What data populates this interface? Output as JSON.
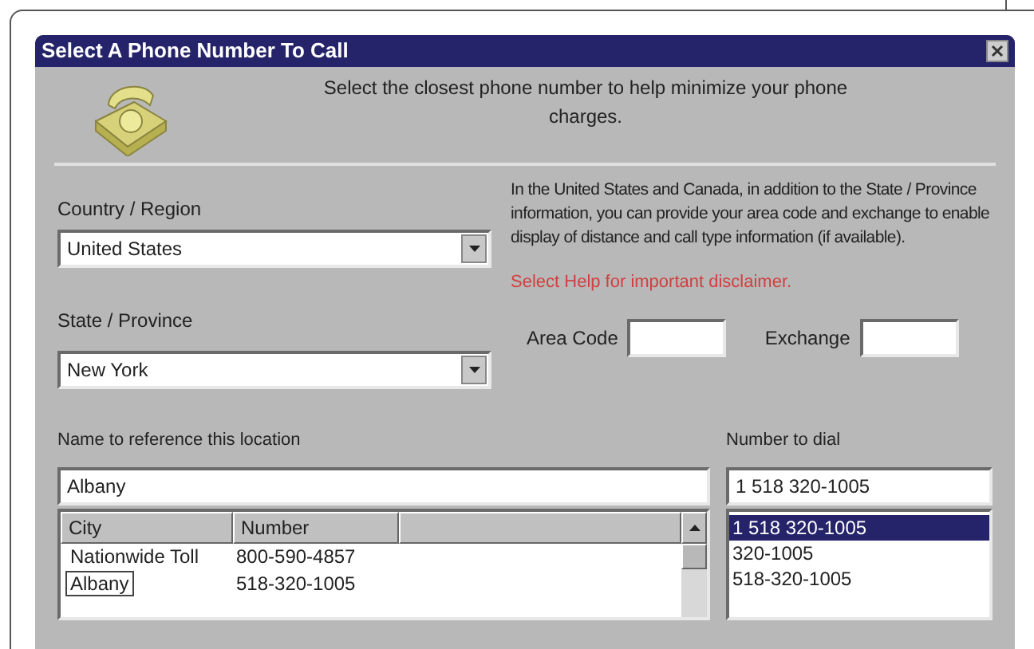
{
  "window": {
    "title": "Select A Phone Number To Call"
  },
  "intro": "Select the closest phone number to help minimize your phone charges.",
  "country": {
    "label": "Country / Region",
    "value": "United States"
  },
  "state": {
    "label": "State / Province",
    "value": "New York"
  },
  "info": "In the United States and Canada, in addition to the State / Province information, you can provide your area code and exchange to enable display of distance and call type information (if available).",
  "help_note": "Select Help for important disclaimer.",
  "area_code": {
    "label": "Area Code"
  },
  "exchange": {
    "label": "Exchange"
  },
  "location_name": {
    "label": "Name to reference this location",
    "value": "Albany"
  },
  "table": {
    "columns": [
      "City",
      "Number"
    ],
    "rows": [
      {
        "city": "Nationwide Toll",
        "number": "800-590-4857",
        "selected": false
      },
      {
        "city": "Albany",
        "number": "518-320-1005",
        "selected": true
      }
    ]
  },
  "number_to_dial": {
    "label": "Number to dial",
    "value": "1 518 320-1005",
    "options": [
      {
        "label": "1 518 320-1005",
        "selected": true
      },
      {
        "label": "320-1005",
        "selected": false
      },
      {
        "label": "518-320-1005",
        "selected": false
      }
    ]
  }
}
